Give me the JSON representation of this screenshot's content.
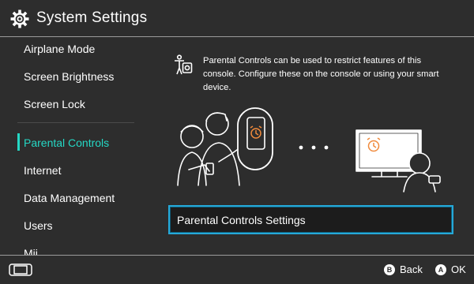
{
  "header": {
    "title": "System Settings",
    "icon": "gear-icon"
  },
  "sidebar": {
    "items": [
      {
        "label": "Airplane Mode",
        "active": false
      },
      {
        "label": "Screen Brightness",
        "active": false
      },
      {
        "label": "Screen Lock",
        "active": false
      },
      {
        "label": "Parental Controls",
        "active": true
      },
      {
        "label": "Internet",
        "active": false
      },
      {
        "label": "Data Management",
        "active": false
      },
      {
        "label": "Users",
        "active": false
      },
      {
        "label": "Mii",
        "active": false
      }
    ]
  },
  "main": {
    "intro_text": "Parental Controls can be used to restrict features of this console. Configure these on the console or using your smart device.",
    "settings_button_label": "Parental Controls Settings"
  },
  "footer": {
    "back_key": "B",
    "back_label": "Back",
    "ok_key": "A",
    "ok_label": "OK"
  },
  "colors": {
    "background": "#2d2d2d",
    "accent": "#25d8c5",
    "focus_border": "#25a9d9",
    "alarm_orange": "#f08a3c"
  }
}
